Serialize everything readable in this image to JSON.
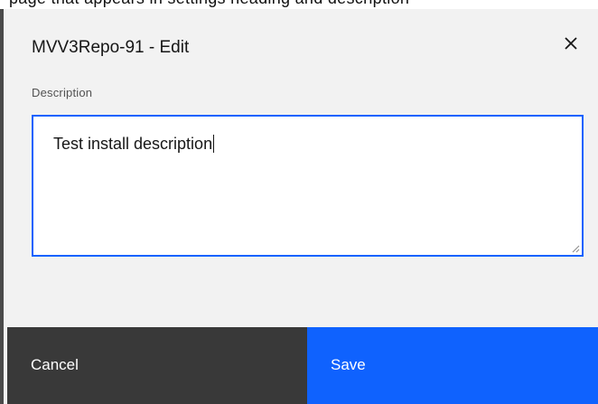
{
  "modal": {
    "title": "MVV3Repo-91 - Edit",
    "description_label": "Description",
    "description_value": "Test install description",
    "cancel_label": "Cancel",
    "save_label": "Save"
  },
  "background": {
    "cutoff_text": "page that appears in settings heading and description"
  },
  "icons": {
    "close": "close-icon",
    "resize": "resize-handle-icon"
  },
  "colors": {
    "primary": "#0f62fe",
    "secondary_button": "#393939",
    "modal_bg": "#f2f2f2",
    "text": "#161616",
    "label": "#525252"
  }
}
